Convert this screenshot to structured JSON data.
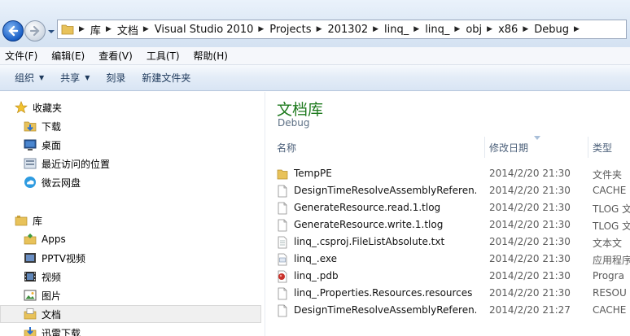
{
  "address_bar": {
    "breadcrumbs": [
      "库",
      "文档",
      "Visual Studio 2010",
      "Projects",
      "201302",
      "linq_",
      "linq_",
      "obj",
      "x86",
      "Debug"
    ]
  },
  "menu": [
    "文件(F)",
    "编辑(E)",
    "查看(V)",
    "工具(T)",
    "帮助(H)"
  ],
  "toolbar": {
    "organize": "组织",
    "share": "共享",
    "burn": "刻录",
    "new_folder": "新建文件夹"
  },
  "nav": {
    "favorites_header": "收藏夹",
    "favorites": [
      "下载",
      "桌面",
      "最近访问的位置",
      "微云网盘"
    ],
    "libraries_header": "库",
    "libraries": [
      "Apps",
      "PPTV视频",
      "视频",
      "图片",
      "文档",
      "迅雷下载"
    ]
  },
  "content": {
    "library_title": "文档库",
    "subtitle": "Debug",
    "columns": {
      "name": "名称",
      "date": "修改日期",
      "type": "类型"
    },
    "files": [
      {
        "name": "TempPE",
        "date": "2014/2/20 21:30",
        "type": "文件夹",
        "icon": "folder-icon"
      },
      {
        "name": "DesignTimeResolveAssemblyReferen...",
        "date": "2014/2/20 21:30",
        "type": "CACHE",
        "icon": "file-icon"
      },
      {
        "name": "GenerateResource.read.1.tlog",
        "date": "2014/2/20 21:30",
        "type": "TLOG 文",
        "icon": "file-icon"
      },
      {
        "name": "GenerateResource.write.1.tlog",
        "date": "2014/2/20 21:30",
        "type": "TLOG 文",
        "icon": "file-icon"
      },
      {
        "name": "linq_.csproj.FileListAbsolute.txt",
        "date": "2014/2/20 21:30",
        "type": "文本文",
        "icon": "text-file-icon"
      },
      {
        "name": "linq_.exe",
        "date": "2014/2/20 21:30",
        "type": "应用程序",
        "icon": "exe-icon"
      },
      {
        "name": "linq_.pdb",
        "date": "2014/2/20 21:30",
        "type": "Progra",
        "icon": "pdb-icon"
      },
      {
        "name": "linq_.Properties.Resources.resources",
        "date": "2014/2/20 21:30",
        "type": "RESOU",
        "icon": "file-icon"
      },
      {
        "name": "DesignTimeResolveAssemblyReferen...",
        "date": "2014/2/20 21:27",
        "type": "CACHE",
        "icon": "file-icon"
      }
    ]
  }
}
